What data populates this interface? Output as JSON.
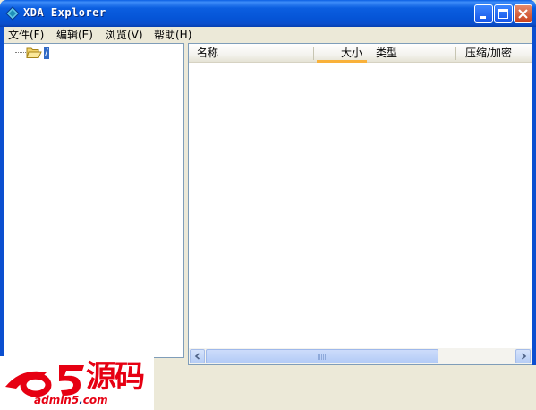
{
  "window": {
    "title": "XDA Explorer"
  },
  "menu": {
    "items": [
      {
        "label": "文件(F)"
      },
      {
        "label": "编辑(E)"
      },
      {
        "label": "浏览(V)"
      },
      {
        "label": "帮助(H)"
      }
    ]
  },
  "tree": {
    "root_label": "/"
  },
  "list": {
    "columns": [
      {
        "label": "名称"
      },
      {
        "label": "大小"
      },
      {
        "label": "类型"
      },
      {
        "label": "压缩/加密"
      }
    ],
    "rows": [],
    "sorted_column": "大小"
  },
  "scrollbar": {
    "grip": "III"
  },
  "watermark": {
    "logo_letter": "a5",
    "text_cn": "源码",
    "url_main": "admin5",
    "url_dot": ".",
    "url_tld": "com"
  },
  "colors": {
    "titlebar": "#0554d6",
    "selection": "#316ac5",
    "sort_highlight": "#f9b13a",
    "watermark_red": "#e60012"
  },
  "icons": [
    "xda-app-icon",
    "minimize-icon",
    "maximize-icon",
    "close-icon",
    "folder-open-icon",
    "arrow-left-icon",
    "arrow-right-icon"
  ]
}
